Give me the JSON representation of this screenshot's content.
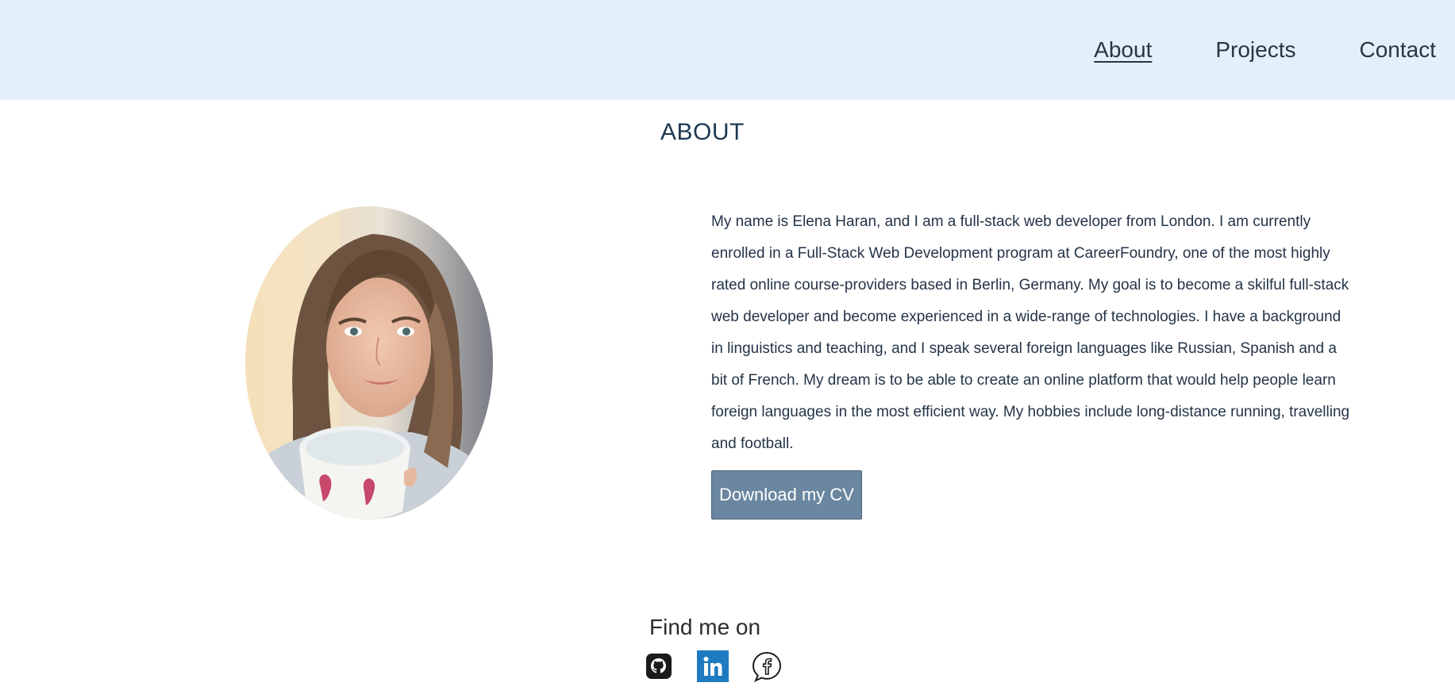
{
  "nav": {
    "items": [
      {
        "label": "About",
        "active": true
      },
      {
        "label": "Projects",
        "active": false
      },
      {
        "label": "Contact",
        "active": false
      }
    ]
  },
  "about": {
    "title": "ABOUT",
    "bio": "My name is Elena Haran, and I am a full-stack web developer from London. I am currently enrolled in a Full-Stack Web Development program at CareerFoundry, one of the most highly rated online course-providers based in Berlin, Germany. My goal is to become a skilful full-stack web developer and become experienced in a wide-range of technologies. I have a background in linguistics and teaching, and I speak several foreign languages like Russian, Spanish and a bit of French. My dream is to be able to create an online platform that would help people learn foreign languages in the most efficient way. My hobbies include long-distance running, travelling and football.",
    "cv_button": "Download my CV"
  },
  "social": {
    "title": "Find me on",
    "icons": [
      "github-icon",
      "linkedin-icon",
      "facebook-icon"
    ]
  },
  "colors": {
    "header_bg": "#e3f0fb",
    "button_bg": "#6a86a0",
    "linkedin": "#1f7bc1"
  }
}
